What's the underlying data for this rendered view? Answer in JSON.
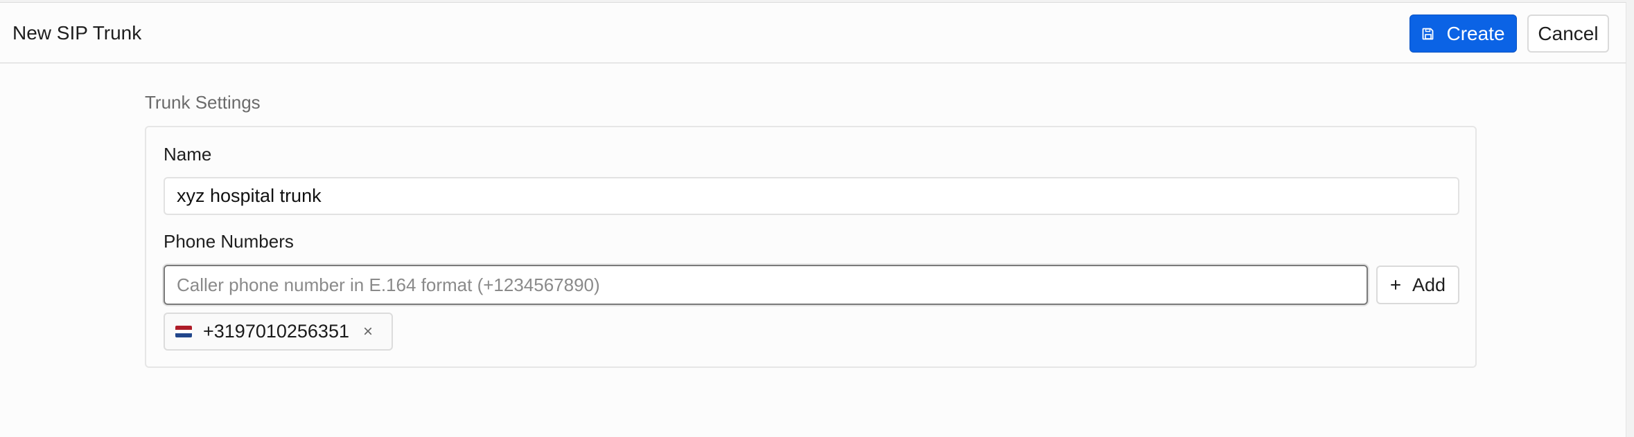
{
  "header": {
    "title": "New SIP Trunk",
    "create_label": "Create",
    "cancel_label": "Cancel"
  },
  "section": {
    "title": "Trunk Settings"
  },
  "form": {
    "name_label": "Name",
    "name_value": "xyz hospital trunk",
    "phones_label": "Phone Numbers",
    "phone_placeholder": "Caller phone number in E.164 format (+1234567890)",
    "add_label": "Add",
    "numbers": [
      {
        "number": "+3197010256351",
        "flag": "netherlands-flag-icon"
      }
    ]
  },
  "colors": {
    "primary": "#0b63e5",
    "flag_nl": [
      "#ae1c28",
      "#ffffff",
      "#21468b"
    ]
  }
}
